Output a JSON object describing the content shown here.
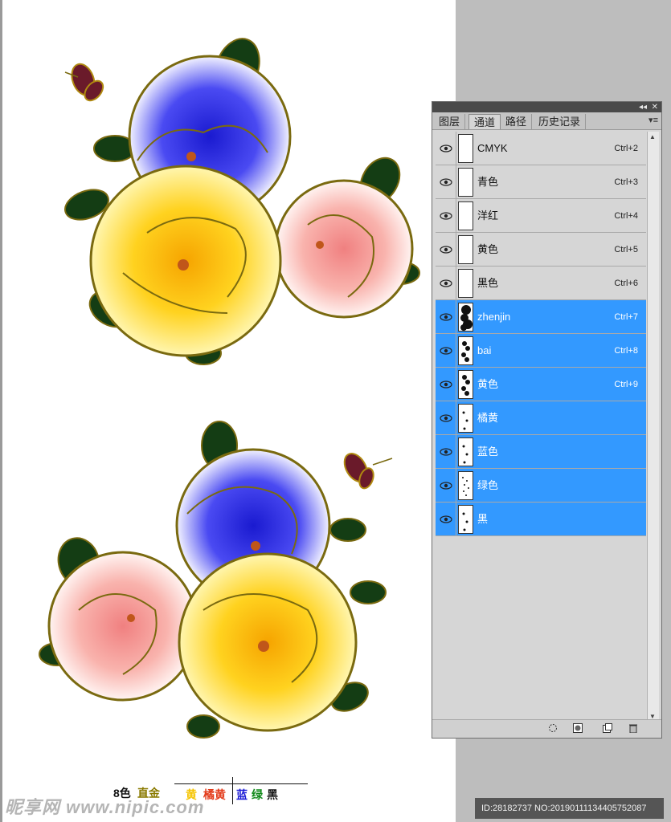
{
  "legend": {
    "count": "8色",
    "gold": "直金",
    "yellow": "黄",
    "orange": "橘黄",
    "blue": "蓝",
    "green": "绿",
    "black": "黑",
    "colors": {
      "gold": "#8a7a00",
      "yellow": "#f5c400",
      "orange": "#e33b1a",
      "blue": "#1b1bd6",
      "green": "#128a1b",
      "black": "#111111"
    }
  },
  "panel": {
    "collapse_label": "◂◂",
    "close_label": "✕",
    "menu_label": "▾≡",
    "tabs": [
      {
        "label": "图层",
        "active": false
      },
      {
        "label": "通道",
        "active": true
      },
      {
        "label": "路径",
        "active": false
      },
      {
        "label": "历史记录",
        "active": false
      }
    ],
    "channels": [
      {
        "name": "CMYK",
        "shortcut": "Ctrl+2",
        "selected": false,
        "thumb": "blank"
      },
      {
        "name": "青色",
        "shortcut": "Ctrl+3",
        "selected": false,
        "thumb": "blank"
      },
      {
        "name": "洋红",
        "shortcut": "Ctrl+4",
        "selected": false,
        "thumb": "blank"
      },
      {
        "name": "黄色",
        "shortcut": "Ctrl+5",
        "selected": false,
        "thumb": "blank"
      },
      {
        "name": "黑色",
        "shortcut": "Ctrl+6",
        "selected": false,
        "thumb": "blank"
      },
      {
        "name": "zhenjin",
        "shortcut": "Ctrl+7",
        "selected": true,
        "thumb": "dense"
      },
      {
        "name": "bai",
        "shortcut": "Ctrl+8",
        "selected": true,
        "thumb": "medium"
      },
      {
        "name": "黄色",
        "shortcut": "Ctrl+9",
        "selected": true,
        "thumb": "medium"
      },
      {
        "name": "橘黄",
        "shortcut": "",
        "selected": true,
        "thumb": "sparse"
      },
      {
        "name": "蓝色",
        "shortcut": "",
        "selected": true,
        "thumb": "sparse"
      },
      {
        "name": "绿色",
        "shortcut": "",
        "selected": true,
        "thumb": "dots"
      },
      {
        "name": "黑",
        "shortcut": "",
        "selected": true,
        "thumb": "sparse"
      }
    ],
    "bottom_icons": [
      "load-selection-icon",
      "save-selection-icon",
      "new-channel-icon",
      "trash-icon"
    ]
  },
  "watermark": {
    "left": "昵享网 www.nipic.com",
    "right": "ID:28182737 NO:20190111134405752087"
  }
}
